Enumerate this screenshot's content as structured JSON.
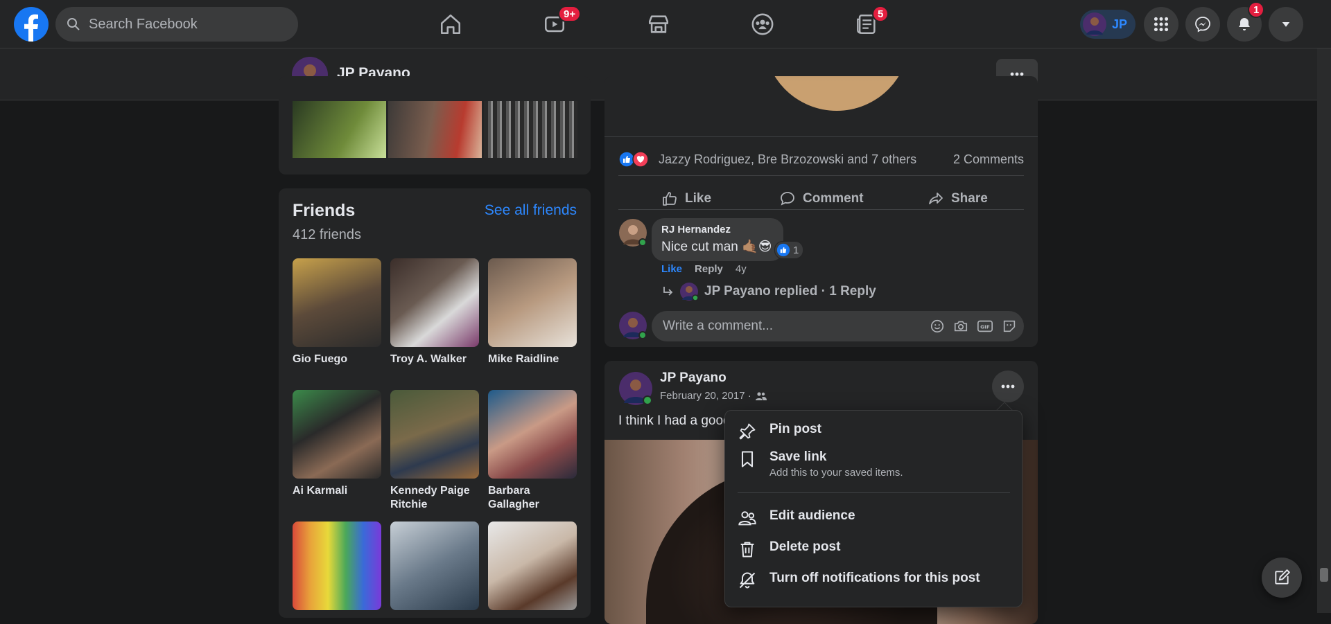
{
  "search": {
    "placeholder": "Search Facebook"
  },
  "nav": {
    "watch_badge": "9+",
    "news_badge": "5",
    "notifications_badge": "1",
    "profile_chip_label": "JP"
  },
  "profile_header": {
    "name": "JP Payano"
  },
  "friends": {
    "title": "Friends",
    "count": "412 friends",
    "see_all": "See all friends",
    "items": [
      {
        "name": "Gio Fuego"
      },
      {
        "name": "Troy A. Walker"
      },
      {
        "name": "Mike Raidline"
      },
      {
        "name": "Ai Karmali"
      },
      {
        "name": "Kennedy Paige Ritchie"
      },
      {
        "name": "Barbara Gallagher"
      }
    ]
  },
  "post1": {
    "reactions_text": "Jazzy Rodriguez, Bre Brzozowski and 7 others",
    "comments_count": "2 Comments",
    "actions": {
      "like": "Like",
      "comment": "Comment",
      "share": "Share"
    },
    "comment": {
      "author": "RJ Hernandez",
      "text": "Nice cut man 🤙🏽😎",
      "like_count": "1",
      "like": "Like",
      "reply": "Reply",
      "time": "4y"
    },
    "replies_link": "JP Payano replied · 1 Reply",
    "write_placeholder": "Write a comment..."
  },
  "post2": {
    "author": "JP Payano",
    "date": "February 20, 2017 ·",
    "text": "I think I had a good"
  },
  "menu": {
    "pin": "Pin post",
    "save": "Save link",
    "save_sub": "Add this to your saved items.",
    "edit_audience": "Edit audience",
    "delete": "Delete post",
    "notifications_off": "Turn off notifications for this post"
  },
  "colors": {
    "accent": "#2d88ff",
    "badge": "#e41e3f",
    "bg": "#18191a",
    "card": "#242526"
  }
}
